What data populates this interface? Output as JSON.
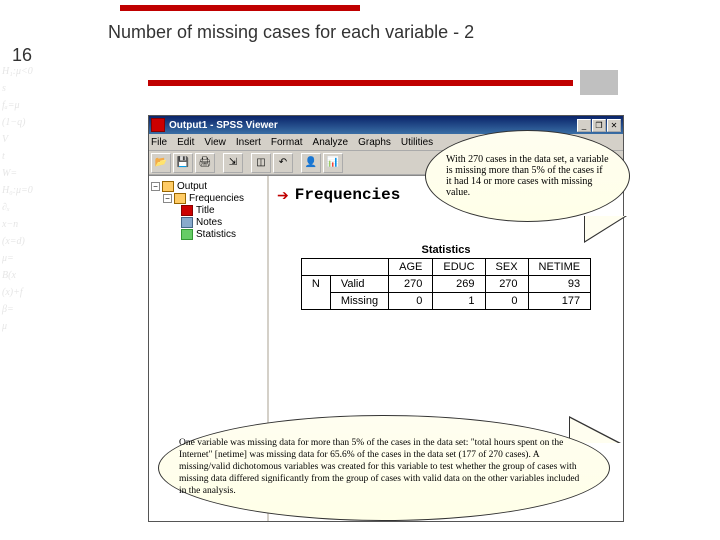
{
  "slide": {
    "title": "Number of missing cases for each variable - 2",
    "page_number": "16"
  },
  "window": {
    "title": "Output1 - SPSS Viewer",
    "menu": [
      "File",
      "Edit",
      "View",
      "Insert",
      "Format",
      "Analyze",
      "Graphs",
      "Utilities"
    ],
    "win_buttons": {
      "min": "_",
      "max": "❐",
      "close": "✕"
    }
  },
  "tree": {
    "output": "Output",
    "frequencies": "Frequencies",
    "title": "Title",
    "notes": "Notes",
    "statistics": "Statistics"
  },
  "content": {
    "heading": "Frequencies",
    "table_caption": "Statistics",
    "columns": [
      "AGE",
      "EDUC",
      "SEX",
      "NETIME"
    ],
    "rowgroup": "N",
    "rows": [
      "Valid",
      "Missing"
    ],
    "data": {
      "valid": [
        "270",
        "269",
        "270",
        "93"
      ],
      "missing": [
        "0",
        "1",
        "0",
        "177"
      ]
    }
  },
  "callouts": {
    "c1": "With 270 cases in the data set, a variable is missing more than 5% of the cases if it had 14 or more cases with missing value.",
    "c2": "One variable was missing data for more than 5% of the cases in the data set: \"total hours spent on the Internet\" [netime] was missing data for 65.6% of the cases in the data set (177 of 270 cases). A missing/valid dichotomous variables was created for this variable to test whether the group of cases with missing data differed significantly from the group of cases with valid data on the other variables included in the analysis."
  },
  "formulas": [
    "H₁:μ<0",
    "s",
    "fₐ=μ",
    "(1−q)",
    "V",
    "t",
    "W=",
    "H₀:μ=0",
    "∂ₓ",
    "x−n",
    "(x=d)",
    "μ=",
    "B(x",
    "(x)+f",
    "β=",
    "μ"
  ]
}
